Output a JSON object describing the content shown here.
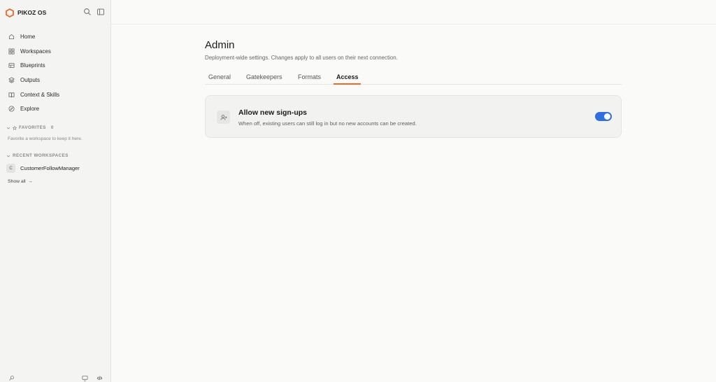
{
  "app": {
    "name": "PIKOZ OS",
    "accent": "#e86a2c",
    "toggle_color": "#2f6fe0"
  },
  "sidebar": {
    "nav": [
      {
        "label": "Home",
        "icon": "home-icon"
      },
      {
        "label": "Workspaces",
        "icon": "grid-icon"
      },
      {
        "label": "Blueprints",
        "icon": "blueprint-icon"
      },
      {
        "label": "Outputs",
        "icon": "layers-icon"
      },
      {
        "label": "Context & Skills",
        "icon": "book-icon"
      },
      {
        "label": "Explore",
        "icon": "compass-icon"
      }
    ],
    "favorites": {
      "label": "FAVORITES",
      "count": "0",
      "hint": "Favorite a workspace to keep it here."
    },
    "recent": {
      "label": "RECENT WORKSPACES",
      "items": [
        {
          "initial": "C",
          "name": "CustomerFollowManager"
        }
      ],
      "show_all": "Show all",
      "show_all_arrow": "→"
    }
  },
  "page": {
    "title": "Admin",
    "subtitle": "Deployment-wide settings. Changes apply to all users on their next connection.",
    "tabs": [
      {
        "label": "General",
        "active": false
      },
      {
        "label": "Gatekeepers",
        "active": false
      },
      {
        "label": "Formats",
        "active": false
      },
      {
        "label": "Access",
        "active": true
      }
    ],
    "setting": {
      "title": "Allow new sign-ups",
      "description": "When off, existing users can still log in but no new accounts can be created.",
      "enabled": true,
      "icon": "user-plus-icon"
    }
  }
}
